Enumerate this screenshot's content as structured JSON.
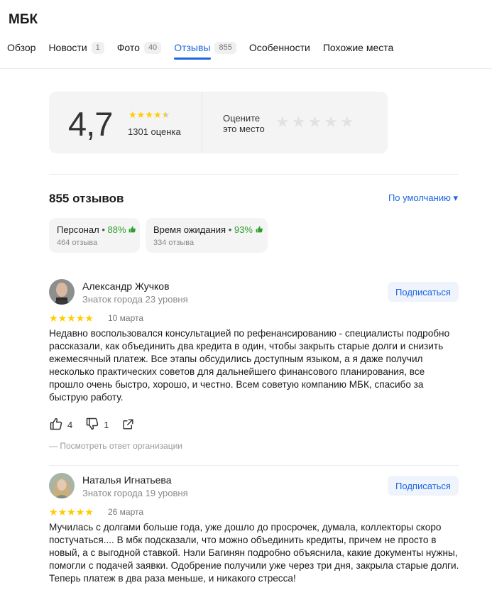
{
  "org_name": "МБК",
  "tabs": [
    {
      "label": "Обзор",
      "count": ""
    },
    {
      "label": "Новости",
      "count": "1"
    },
    {
      "label": "Фото",
      "count": "40"
    },
    {
      "label": "Отзывы",
      "count": "855"
    },
    {
      "label": "Особенности",
      "count": ""
    },
    {
      "label": "Похожие места",
      "count": ""
    }
  ],
  "rating": {
    "score": "4,7",
    "stars_value": 4.7,
    "count_text": "1301 оценка",
    "rate_prompt_line1": "Оцените",
    "rate_prompt_line2": "это место"
  },
  "reviews_header": {
    "title": "855 отзывов",
    "sort_label": "По умолчанию ▾"
  },
  "aspects": [
    {
      "name": "Персонал",
      "percent": "88%",
      "count": "464 отзыва"
    },
    {
      "name": "Время ожидания",
      "percent": "93%",
      "count": "334 отзыва"
    }
  ],
  "reviews": [
    {
      "author": "Александр Жучков",
      "level": "Знаток города 23 уровня",
      "subscribe_label": "Подписаться",
      "stars": 5,
      "date": "10 марта",
      "text": "Недавно воспользовался консультацией по рефенансированию - специалисты подробно рассказали, как объединить два кредита в один, чтобы закрыть старые долги и снизить ежемесячный платеж. Все этапы обсудились доступным языком, а я даже получил несколько практических советов для дальнейшего финансового планирования, все прошло очень быстро, хорошо, и честно. Всем советую компанию МБК, спасибо за быструю работу.",
      "likes": "4",
      "dislikes": "1",
      "org_reply_label": "— Посмотреть ответ организации"
    },
    {
      "author": "Наталья Игнатьева",
      "level": "Знаток города 19 уровня",
      "subscribe_label": "Подписаться",
      "stars": 5,
      "date": "26 марта",
      "text": "Мучилась с долгами больше года, уже дошло до просрочек, думала, коллекторы скоро постучаться.... В мбк подсказали, что можно объединить кредиты, причем не просто в новый, а с выгодной ставкой. Нэли Багинян подробно объяснила, какие документы нужны, помогли с подачей заявки. Одобрение получили уже через три дня, закрыла старые долги. Теперь платеж в два раза меньше, и никакого стресса!"
    }
  ],
  "colors": {
    "accent": "#1a66e0",
    "star": "#ffcc00",
    "positive": "#2da02d"
  }
}
